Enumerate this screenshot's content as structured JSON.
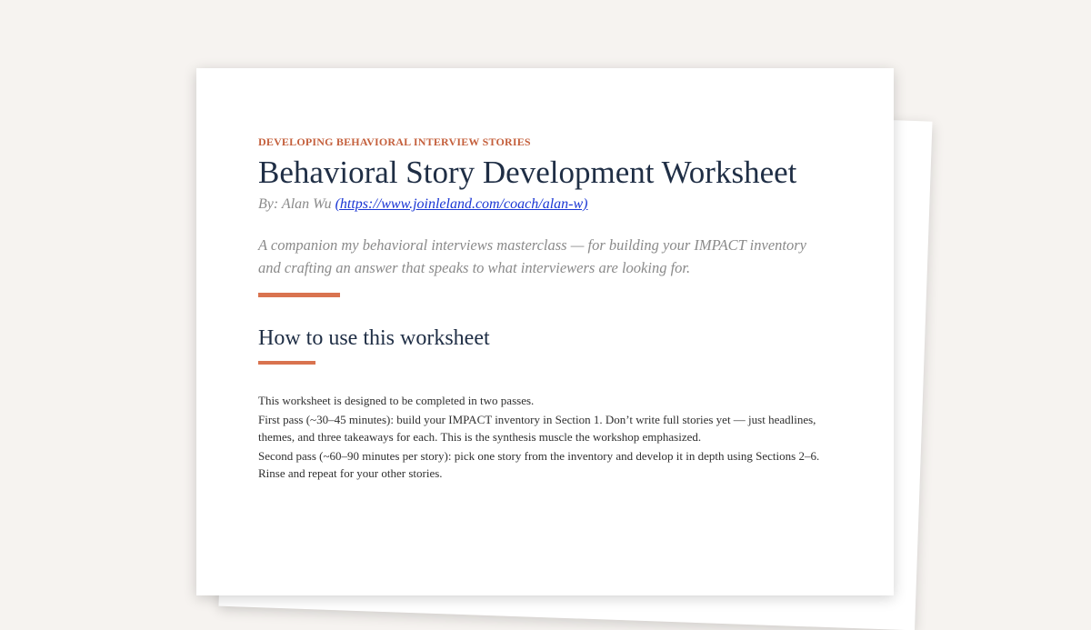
{
  "document": {
    "eyebrow": "DEVELOPING BEHAVIORAL INTERVIEW STORIES",
    "title": "Behavioral Story Development Worksheet",
    "byline_prefix": "By: Alan Wu ",
    "byline_link": "(https://www.joinleland.com/coach/alan-w)",
    "intro": "A companion my behavioral interviews masterclass — for building your IMPACT inventory and crafting an answer that speaks to what interviewers are looking for.",
    "section_heading": "How to use this worksheet",
    "paragraphs": [
      "This worksheet is designed to be completed in two passes.",
      "First pass (~30–45 minutes): build your IMPACT inventory in Section 1. Don’t write full stories yet — just headlines, themes, and three takeaways for each. This is the synthesis muscle the workshop emphasized.",
      "Second pass (~60–90 minutes per story): pick one story from the inventory and develop it in depth using Sections 2–6. Rinse and repeat for your other stories."
    ]
  },
  "colors": {
    "background": "#f6f3f0",
    "accent": "#d9734f",
    "eyebrow": "#c4603d",
    "heading": "#1f2e45",
    "link": "#1a36d4"
  }
}
